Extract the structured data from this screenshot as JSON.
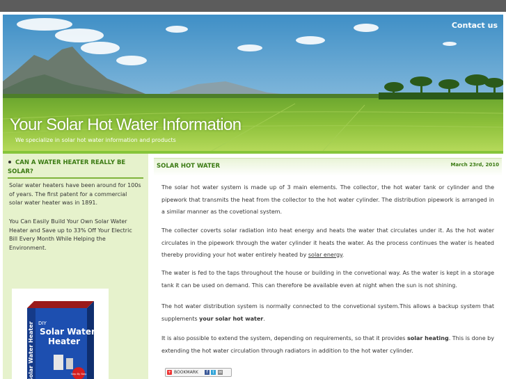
{
  "header": {
    "contact_label": "Contact us",
    "site_title": "Your Solar Hot Water Information",
    "tagline": "We specialize in solar hot water information and products"
  },
  "sidebar": {
    "title": "CAN A WATER HEATER REALLY BE SOLAR?",
    "paragraphs": [
      "Solar water heaters have been around for 100s of years. The first patent for a commercial solar water heater was in 1891.",
      "You Can Easily Build Your Own Solar Water Heater and Save up to 33% Off Your Electric Bill Every Month While Helping the Environment."
    ],
    "book": {
      "prefix": "DIY",
      "title_line1": "Solar Water",
      "title_line2": "Heater",
      "spine": "Solar Water Heater",
      "badge": "Step By Step"
    }
  },
  "post": {
    "title": "SOLAR HOT WATER",
    "date": "March 23rd, 2010",
    "p1": "The solar hot water system is made up of 3 main elements. The collector, the hot water tank or cylinder and the pipework that transmits the heat from the collector to the hot water cylinder. The distribution pipework is arranged in a similar manner as the covetional system.",
    "p2_text": "The collecter coverts solar radiation into heat energy and heats the water that circulates under it. As the hot water circulates in the pipework through the water cylinder it heats the water. As the process continues the water is heated thereby providing your hot water entirely heated by ",
    "p2_link": "solar energy",
    "p2_end": ".",
    "p3": "The water is fed to the taps throughout the house or building in the convetional way. As the water is kept in a storage tank it can be used on demand. This can therefore be available even at night when the sun is not shining.",
    "p4_text": "The hot water distribution system is normally connected to the convetional system.This allows a backup system that supplements ",
    "p4_bold": "your solar hot water",
    "p4_end": ".",
    "p5_text": "It is also possible to extend the system, depending on requirements, so that it provides ",
    "p5_bold": "solar heating",
    "p5_end": ". This is done by extending the hot water circulation through radiators in addition to the hot water cylinder.",
    "bookmark_label": "BOOKMARK"
  },
  "colors": {
    "accent_green": "#3a7a12",
    "sidebar_bg": "#e6f2cc",
    "top_bar": "#5c5c5c"
  }
}
